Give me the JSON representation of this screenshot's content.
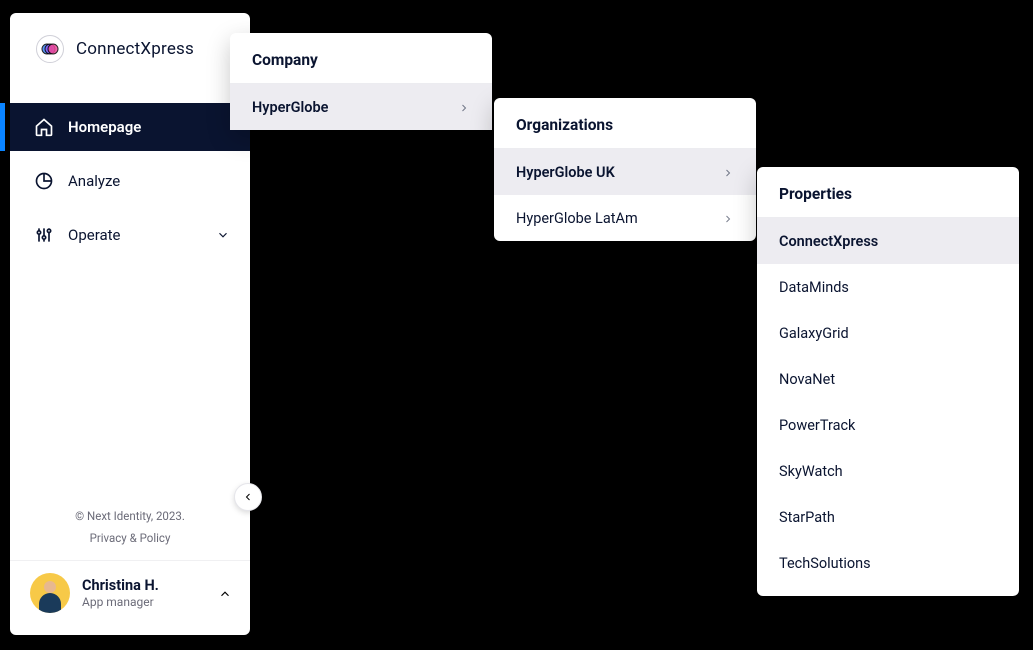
{
  "app": {
    "title": "ConnectXpress"
  },
  "sidebar": {
    "items": [
      {
        "label": "Homepage"
      },
      {
        "label": "Analyze"
      },
      {
        "label": "Operate"
      }
    ],
    "footer": {
      "copyright": "© Next Identity, 2023.",
      "policy": "Privacy & Policy"
    },
    "user": {
      "name": "Christina H.",
      "role": "App manager"
    }
  },
  "panels": {
    "company": {
      "title": "Company",
      "items": [
        {
          "label": "HyperGlobe"
        }
      ]
    },
    "organizations": {
      "title": "Organizations",
      "items": [
        {
          "label": "HyperGlobe UK"
        },
        {
          "label": "HyperGlobe LatAm"
        }
      ]
    },
    "properties": {
      "title": "Properties",
      "items": [
        {
          "label": "ConnectXpress"
        },
        {
          "label": "DataMinds"
        },
        {
          "label": "GalaxyGrid"
        },
        {
          "label": "NovaNet"
        },
        {
          "label": "PowerTrack"
        },
        {
          "label": "SkyWatch"
        },
        {
          "label": "StarPath"
        },
        {
          "label": "TechSolutions"
        }
      ]
    }
  }
}
